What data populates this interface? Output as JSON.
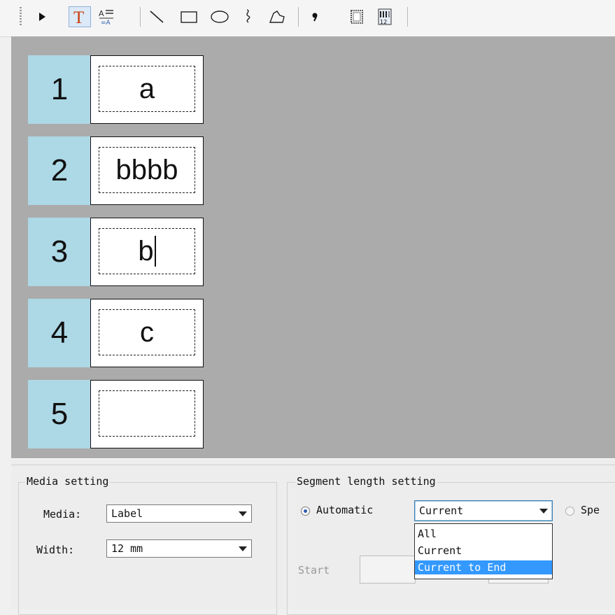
{
  "toolbar": {
    "tools": [
      {
        "name": "select",
        "icon": "pointer-arrow-icon",
        "active": false
      },
      {
        "name": "text",
        "icon": "text-t-icon",
        "active": true
      },
      {
        "name": "text-format",
        "icon": "text-format-icon",
        "active": false
      },
      {
        "name": "line",
        "icon": "line-icon",
        "active": false
      },
      {
        "name": "rectangle",
        "icon": "rectangle-icon",
        "active": false
      },
      {
        "name": "ellipse",
        "icon": "ellipse-icon",
        "active": false
      },
      {
        "name": "freehand",
        "icon": "freehand-icon",
        "active": false
      },
      {
        "name": "polygon",
        "icon": "polygon-icon",
        "active": false
      },
      {
        "name": "symbol",
        "icon": "symbol-icon",
        "active": false
      },
      {
        "name": "frame",
        "icon": "frame-icon",
        "active": false
      },
      {
        "name": "numbering",
        "icon": "numbering-icon",
        "active": false
      }
    ],
    "accent": "#8fb0d8"
  },
  "canvas": {
    "background": "#ababab",
    "segment_color": "#add8e6",
    "segments": [
      {
        "number": "1",
        "text": "a",
        "cursor": false
      },
      {
        "number": "2",
        "text": "bbbb",
        "cursor": false
      },
      {
        "number": "3",
        "text": "b",
        "cursor": true
      },
      {
        "number": "4",
        "text": "c",
        "cursor": false
      },
      {
        "number": "5",
        "text": "",
        "cursor": false
      }
    ]
  },
  "media_setting": {
    "title": "Media setting",
    "media_label": "Media:",
    "media_value": "Label",
    "width_label": "Width:",
    "width_value": "12 mm"
  },
  "segment_length": {
    "title": "Segment length setting",
    "automatic_label": "Automatic",
    "automatic_selected": true,
    "combo_value": "Current",
    "specify_label": "Spe",
    "start_label": "Start",
    "dropdown_options": [
      {
        "label": "All",
        "selected": false
      },
      {
        "label": "Current",
        "selected": false
      },
      {
        "label": "Current to End",
        "selected": true
      }
    ],
    "highlight_color": "#3399ff"
  }
}
